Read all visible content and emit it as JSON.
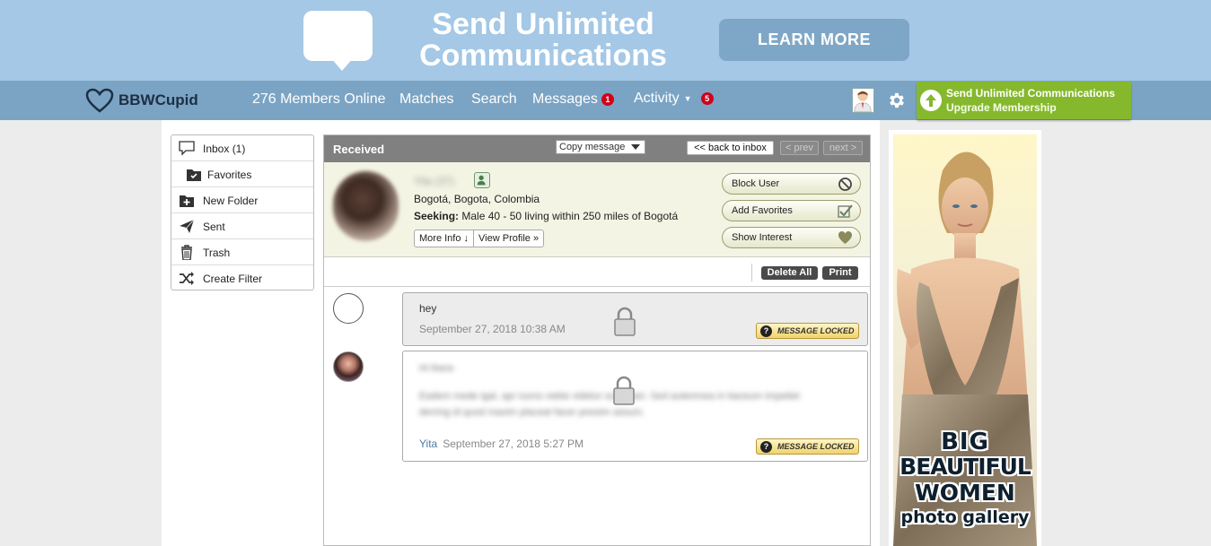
{
  "banner": {
    "title": "Send Unlimited Communications",
    "cta": "LEARN MORE"
  },
  "nav": {
    "brand": "BBWCupid",
    "members_online": "276 Members Online",
    "matches": "Matches",
    "search": "Search",
    "messages": "Messages",
    "messages_badge": "1",
    "activity": "Activity",
    "activity_badge": "5",
    "upgrade_line1": "Send Unlimited Communications",
    "upgrade_line2": "Upgrade Membership"
  },
  "sidebar": {
    "items": [
      {
        "label": "Inbox (1)"
      },
      {
        "label": "Favorites"
      },
      {
        "label": "New Folder"
      },
      {
        "label": "Sent"
      },
      {
        "label": "Trash"
      },
      {
        "label": "Create Filter"
      }
    ]
  },
  "panel": {
    "title": "Received",
    "copy_select": "Copy message",
    "back": "<< back to inbox",
    "prev": "< prev",
    "next": "next >",
    "profile": {
      "name": "Yita (37)",
      "location": "Bogotá, Bogota, Colombia",
      "seeking_label": "Seeking:",
      "seeking": "Male 40 - 50 living within 250 miles of Bogotá",
      "more_info": "More Info ↓",
      "view_profile": "View Profile »",
      "block": "Block User",
      "favorite": "Add Favorites",
      "interest": "Show Interest"
    },
    "toolbar": {
      "delete_all": "Delete All",
      "print": "Print"
    },
    "messages": [
      {
        "text": "hey",
        "date": "September 27, 2018 10:38 AM",
        "locked_label": "MESSAGE LOCKED"
      },
      {
        "greeting": "Hi there",
        "body_line1": "Eadem mede igal, apr iuono nebie videtur sum diari. Sed autemnea in tiaceum impetiet",
        "body_line2": "derring id quod maxim placeat facer possim assum.",
        "sender": "Yita",
        "date": "September 27, 2018 5:27 PM",
        "locked_label": "MESSAGE LOCKED"
      }
    ]
  },
  "ad": {
    "line1": "BIG",
    "line2": "BEAUTIFUL",
    "line3": "WOMEN",
    "line4": "photo gallery"
  },
  "colors": {
    "banner": "#a4c8e6",
    "nav": "#7ba4c4",
    "upgrade": "#86b82e",
    "badge": "#d0021b"
  }
}
